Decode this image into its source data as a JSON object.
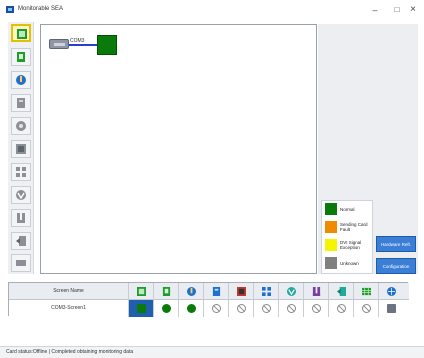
{
  "window": {
    "title": "Monitorable SEA",
    "minimize_label": "–",
    "maximize_label": "□",
    "close_label": "×"
  },
  "toolbar": {
    "buttons": [
      {
        "icon": "monitor-view-icon",
        "color": "#1f9c2b",
        "active": true
      },
      {
        "icon": "card-icon",
        "color": "#1f9c2b"
      },
      {
        "icon": "temperature-icon",
        "color": "#1f6fd1"
      },
      {
        "icon": "module-icon",
        "color": "#8b8f97"
      },
      {
        "icon": "disk-icon",
        "color": "#8b8f97"
      },
      {
        "icon": "chip-icon",
        "color": "#8b8f97"
      },
      {
        "icon": "fan-icon",
        "color": "#8b8f97"
      },
      {
        "icon": "voltage-icon",
        "color": "#8b8f97"
      },
      {
        "icon": "power-icon",
        "color": "#8b8f97"
      },
      {
        "icon": "door-icon",
        "color": "#8b8f97"
      },
      {
        "icon": "screen-icon",
        "color": "#8b8f97"
      }
    ]
  },
  "canvas": {
    "port_label": "COM3"
  },
  "legend": {
    "items": [
      {
        "label": "Normal",
        "color": "#0a7a0a"
      },
      {
        "label": "Sending Card Fault",
        "color": "#f08a00"
      },
      {
        "label": "DVI Signal Exception",
        "color": "#f5f500"
      },
      {
        "label": "Unknown",
        "color": "#808080"
      }
    ]
  },
  "side_buttons": {
    "hardware_label": "Hardware Refr.",
    "configuration_label": "Configuration"
  },
  "grid": {
    "header_name": "Screen Name",
    "header_icons": [
      "monitor-view-icon",
      "card-icon",
      "temperature-icon",
      "module-icon",
      "disk-icon",
      "chip-icon",
      "fan-icon",
      "voltage-icon",
      "power-icon",
      "door-icon",
      "screen-icon",
      "network-icon"
    ],
    "rows": [
      {
        "name": "COM3-Screen1",
        "cells": [
          "square",
          "dot",
          "dot",
          "nosig",
          "nosig",
          "nosig",
          "nosig",
          "nosig",
          "nosig",
          "nosig",
          "nosig",
          "monitor"
        ]
      }
    ]
  },
  "status": {
    "text": "Card status:Offline  |  Completed obtaining monitoring data"
  }
}
